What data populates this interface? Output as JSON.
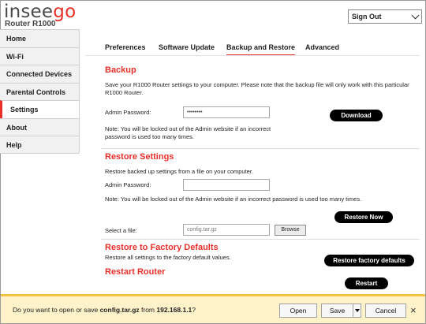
{
  "header": {
    "logo_text_a": "insee",
    "logo_text_b": "go",
    "model": "Router R1000",
    "signout": "Sign Out",
    "accent_color": "#e8302a"
  },
  "sidebar": {
    "items": [
      {
        "label": "Home"
      },
      {
        "label": "Wi-Fi"
      },
      {
        "label": "Connected Devices"
      },
      {
        "label": "Parental Controls"
      },
      {
        "label": "Settings",
        "active": true
      },
      {
        "label": "About"
      },
      {
        "label": "Help"
      }
    ]
  },
  "tabs": [
    "Preferences",
    "Software Update",
    "Backup and Restore",
    "Advanced"
  ],
  "active_tab": "Backup and Restore",
  "backup": {
    "title": "Backup",
    "desc": "Save your R1000 Router settings to your computer. Please note that the backup file will only work with this particular R1000 Router.",
    "password_label": "Admin Password:",
    "password_value": "••••••••",
    "download_label": "Download",
    "note": "Note: You will be locked out of the Admin website if an incorrect password is used too many times."
  },
  "restore": {
    "title": "Restore Settings",
    "desc": "Restore backed up settings from a file on your computer.",
    "password_label": "Admin Password:",
    "password_value": "",
    "note": "Note: You will be locked out of the Admin website if an incorrect password is used too many times.",
    "restore_now_label": "Restore Now",
    "file_label": "Select a file:",
    "file_value": "config.tar.gz",
    "browse_label": "Browse"
  },
  "factory": {
    "title": "Restore to Factory Defaults",
    "desc": "Restore all settings to the factory default values.",
    "button": "Restore factory defaults"
  },
  "restart": {
    "title": "Restart Router",
    "button": "Restart"
  },
  "download_bar": {
    "prefix": "Do you want to open or save ",
    "filename": "config.tar.gz",
    "middle": " from ",
    "host": "192.168.1.1",
    "suffix": "?",
    "open": "Open",
    "save": "Save",
    "cancel": "Cancel",
    "close": "×"
  }
}
